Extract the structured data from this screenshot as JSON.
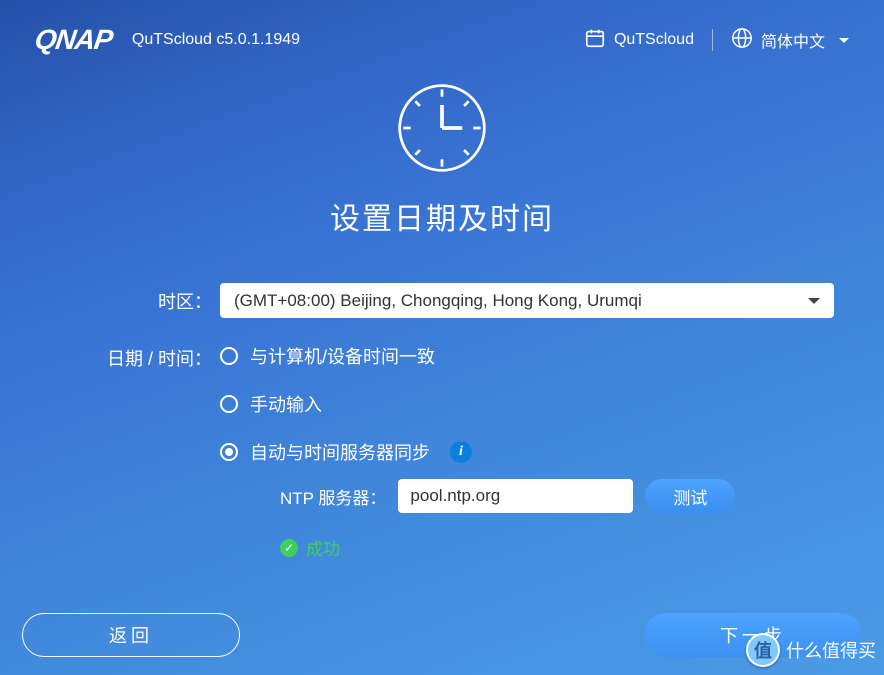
{
  "header": {
    "brand": "QNAP",
    "version": "QuTScloud c5.0.1.1949",
    "product_link": "QuTScloud",
    "language": "简体中文"
  },
  "page": {
    "title": "设置日期及时间"
  },
  "form": {
    "timezone_label": "时区：",
    "timezone_value": "(GMT+08:00) Beijing, Chongqing, Hong Kong, Urumqi",
    "datetime_label": "日期 / 时间：",
    "radio_options": {
      "sync_device": "与计算机/设备时间一致",
      "manual": "手动输入",
      "ntp_sync": "自动与时间服务器同步"
    },
    "ntp": {
      "label": "NTP 服务器：",
      "value": "pool.ntp.org",
      "test_label": "测试"
    },
    "status_text": "成功"
  },
  "buttons": {
    "back": "返回",
    "next": "下一步"
  },
  "watermark": {
    "badge": "值",
    "text": "什么值得买"
  }
}
